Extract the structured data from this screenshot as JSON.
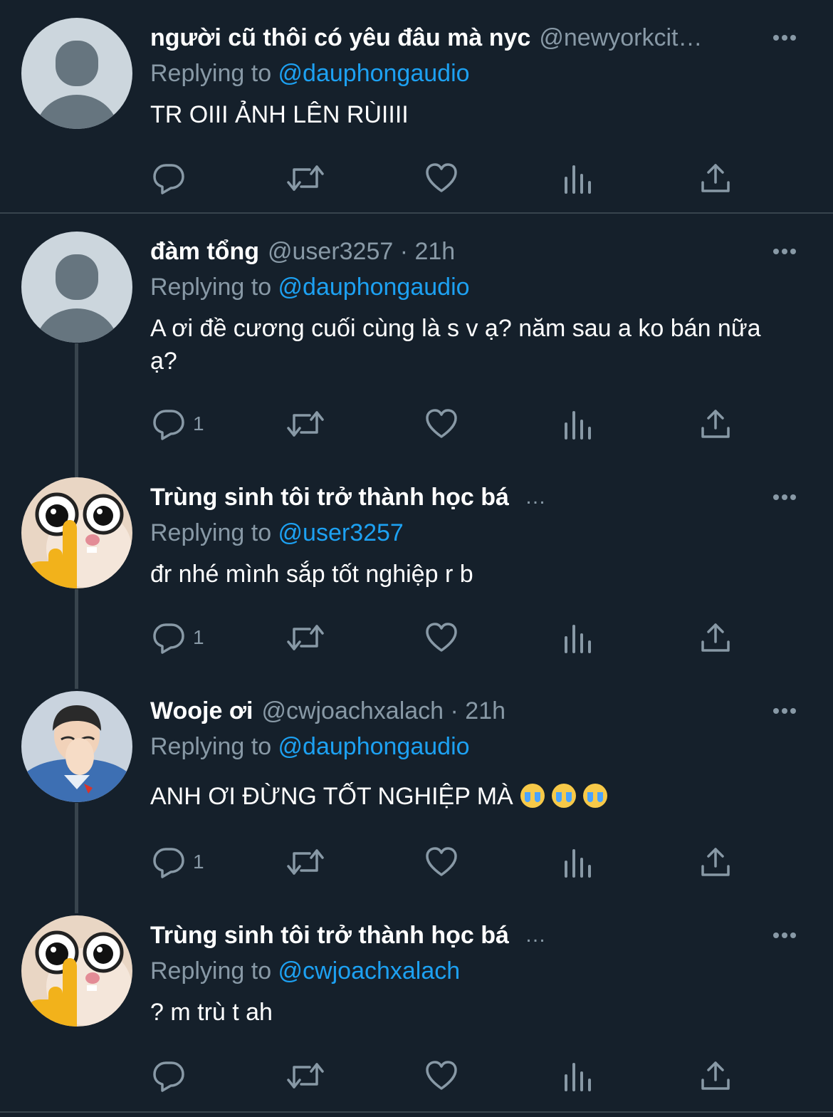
{
  "tweets": [
    {
      "name": "người cũ thôi có yêu đâu mà nyc",
      "handle": "@newyorkcit…",
      "time": "",
      "replying_label": "Replying to ",
      "replying_to": "@dauphongaudio",
      "text": "TR OIII ẢNH LÊN RÙIIII",
      "avatar": "default-avatar",
      "reply_count": ""
    },
    {
      "name": "đàm tổng",
      "handle": "@user3257 · 21h",
      "replying_label": "Replying to ",
      "replying_to": "@dauphongaudio",
      "text": "A ơi đề cương cuối cùng là s v ạ? năm sau a ko bán nữa ạ?",
      "avatar": "default-avatar",
      "reply_count": "1"
    },
    {
      "name": "Trùng sinh tôi trở thành học bá",
      "handle": "…",
      "replying_label": "Replying to ",
      "replying_to": "@user3257",
      "text": "đr nhé mình sắp tốt nghiệp r b",
      "avatar": "cat-glasses-avatar",
      "reply_count": "1"
    },
    {
      "name": "Wooje ơi",
      "handle": "@cwjoachxalach · 21h",
      "replying_label": "Replying to ",
      "replying_to": "@dauphongaudio",
      "text": "ANH ƠI ĐỪNG TỐT NGHIỆP MÀ",
      "emoji": [
        "loudly-crying-face",
        "loudly-crying-face",
        "loudly-crying-face"
      ],
      "avatar": "person-photo-avatar",
      "reply_count": "1"
    },
    {
      "name": "Trùng sinh tôi trở thành học bá",
      "handle": "…",
      "replying_label": "Replying to ",
      "replying_to": "@cwjoachxalach",
      "text": "? m trù t ah",
      "avatar": "cat-glasses-avatar",
      "reply_count": ""
    }
  ],
  "icons": [
    "reply-icon",
    "retweet-icon",
    "like-icon",
    "analytics-icon",
    "share-icon",
    "more-icon"
  ],
  "colors": {
    "background": "#15202b",
    "secondary_text": "#8899a6",
    "link": "#1da1f2",
    "divider": "#38444d"
  }
}
